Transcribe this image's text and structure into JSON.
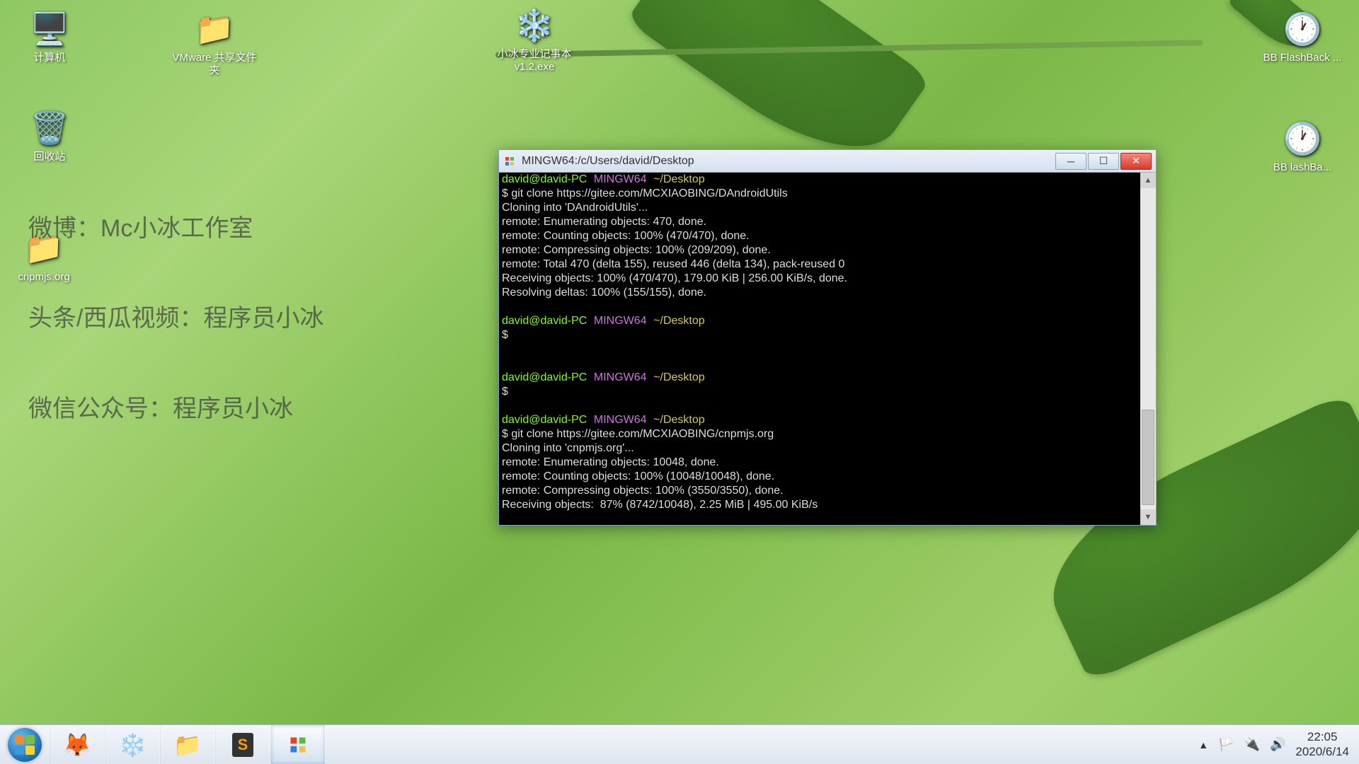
{
  "desktop_icons": {
    "computer": "计算机",
    "recycle": "回收站",
    "vmware": "VMware 共享文件夹",
    "cnpm": "cnpmjs.org",
    "notepad": "小冰专业记事本 v1.2.exe",
    "bb1": "BB FlashBack ...",
    "bb2": "BB lashBa..."
  },
  "watermarks": {
    "weibo": "微博：Mc小冰工作室",
    "toutiao": "头条/西瓜视频：程序员小冰",
    "wechat": "微信公众号：程序员小冰"
  },
  "terminal": {
    "title": "MINGW64:/c/Users/david/Desktop",
    "prompt_user": "david@david-PC",
    "prompt_host": "MINGW64",
    "prompt_path": "~/Desktop",
    "cmd1": "$ git clone https://gitee.com/MCXIAOBING/DAndroidUtils",
    "out1a": "Cloning into 'DAndroidUtils'...",
    "out1b": "remote: Enumerating objects: 470, done.",
    "out1c": "remote: Counting objects: 100% (470/470), done.",
    "out1d": "remote: Compressing objects: 100% (209/209), done.",
    "out1e": "remote: Total 470 (delta 155), reused 446 (delta 134), pack-reused 0",
    "out1f": "Receiving objects: 100% (470/470), 179.00 KiB | 256.00 KiB/s, done.",
    "out1g": "Resolving deltas: 100% (155/155), done.",
    "dollar": "$",
    "cmd2": "$ git clone https://gitee.com/MCXIAOBING/cnpmjs.org",
    "out2a": "Cloning into 'cnpmjs.org'...",
    "out2b": "remote: Enumerating objects: 10048, done.",
    "out2c": "remote: Counting objects: 100% (10048/10048), done.",
    "out2d": "remote: Compressing objects: 100% (3550/3550), done.",
    "out2e": "Receiving objects:  87% (8742/10048), 2.25 MiB | 495.00 KiB/s"
  },
  "tray": {
    "time": "22:05",
    "date": "2020/6/14"
  }
}
